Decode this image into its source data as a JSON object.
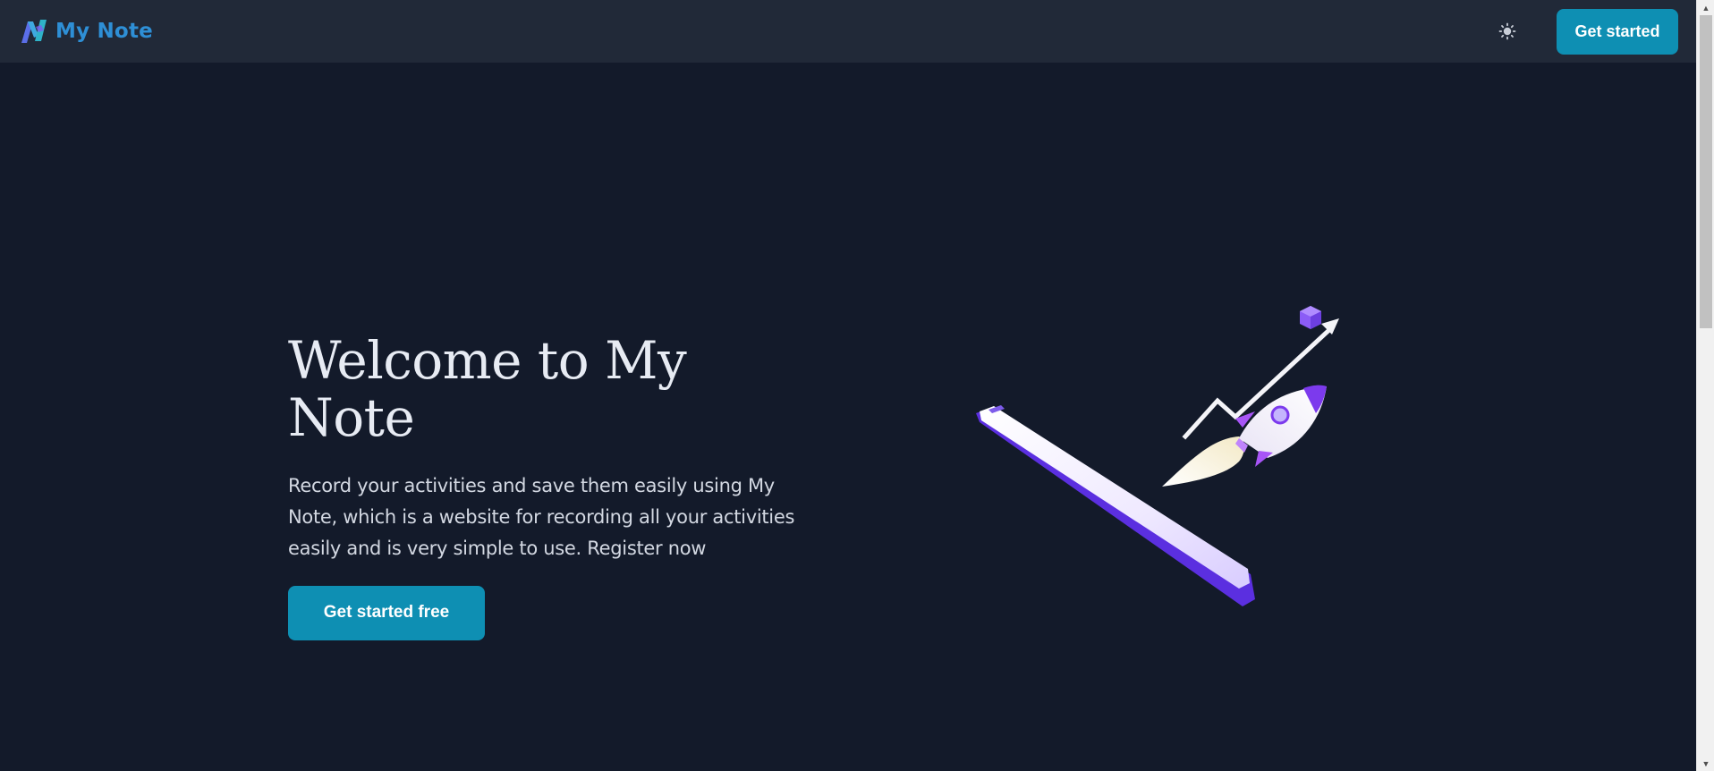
{
  "header": {
    "brand_name": "My Note",
    "logo_icon": "my-note-logo",
    "theme_toggle_icon": "sun-icon",
    "cta_label": "Get started"
  },
  "hero": {
    "title": "Welcome to My Note",
    "description": "Record your activities and save them easily using My Note, which is a website for recording all your activities easily and is very simple to use. Register now",
    "cta_label": "Get started free",
    "illustration": "rocket-launch-from-phone-illustration"
  },
  "colors": {
    "page_background": "#131a2a",
    "header_background": "#212938",
    "brand_blue": "#2e8fd6",
    "primary_button": "#0e8fb3",
    "illustration_purple": "#6a3cf0"
  }
}
